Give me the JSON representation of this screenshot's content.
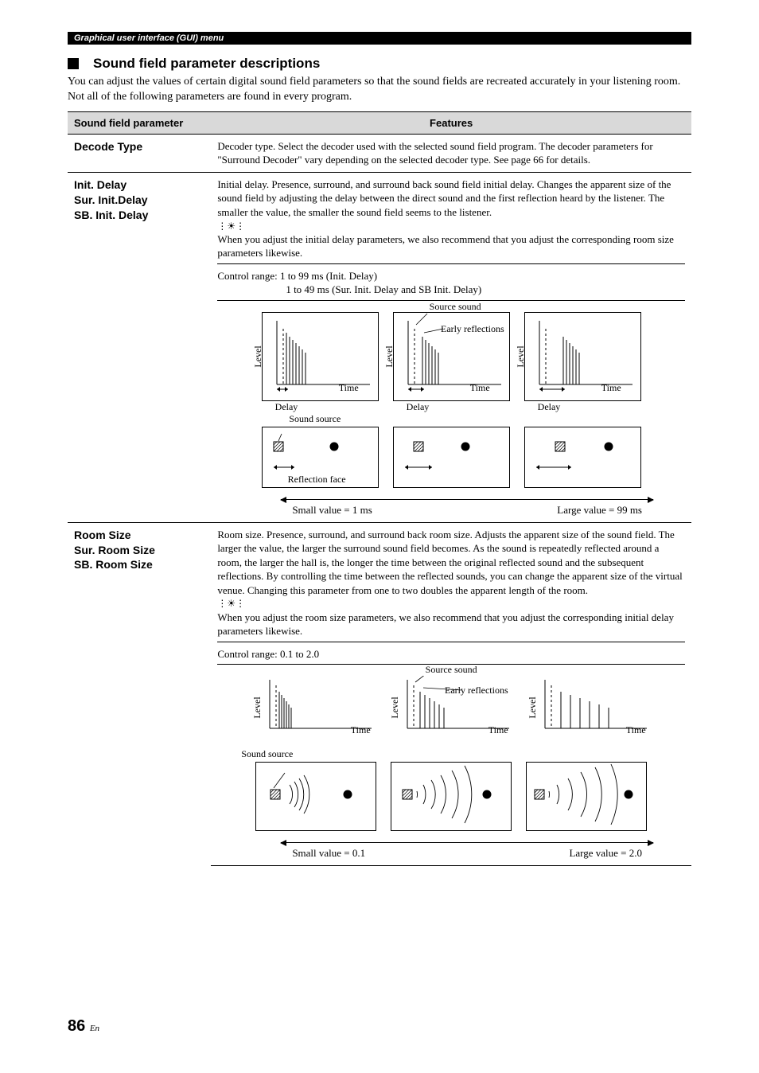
{
  "header_bar": "Graphical user interface (GUI) menu",
  "section_title": "Sound field parameter descriptions",
  "intro": "You can adjust the values of certain digital sound field parameters so that the sound fields are recreated accurately in your listening room. Not all of the following parameters are found in every program.",
  "table": {
    "col1": "Sound field parameter",
    "col2": "Features"
  },
  "rows": {
    "decode": {
      "name": "Decode Type",
      "feat": "Decoder type. Select the decoder used with the selected sound field program. The decoder parameters for \"Surround Decoder\" vary depending on the selected decoder type. See page 66 for details."
    },
    "init_delay": {
      "name1": "Init. Delay",
      "name2": "Sur. Init.Delay",
      "name3": "SB. Init. Delay",
      "feat_p1": "Initial delay. Presence, surround, and surround back sound field initial delay. Changes the apparent size of the sound field by adjusting the delay between the direct sound and the first reflection heard by the listener. The smaller the value, the smaller the sound field seems to the listener.",
      "feat_p2": "When you adjust the initial delay parameters, we also recommend that you adjust the corresponding room size parameters likewise.",
      "range1": "Control range: 1 to 99 ms (Init. Delay)",
      "range2": "1 to 49 ms (Sur. Init. Delay and SB Init. Delay)",
      "label_level": "Level",
      "label_time": "Time",
      "label_delay": "Delay",
      "label_source_sound": "Source sound",
      "label_early": "Early reflections",
      "label_sound_source": "Sound source",
      "label_reflection_face": "Reflection face",
      "small_v": "Small value = 1 ms",
      "large_v": "Large value = 99 ms"
    },
    "room_size": {
      "name1": "Room Size",
      "name2": "Sur. Room Size",
      "name3": "SB. Room Size",
      "feat_p1": "Room size. Presence, surround, and surround back room size. Adjusts the apparent size of the sound field. The larger the value, the larger the surround sound field becomes. As the sound is repeatedly reflected around a room, the larger the hall is, the longer the time between the original reflected sound and the subsequent reflections. By controlling the time between the reflected sounds, you can change the apparent size of the virtual venue. Changing this parameter from one to two doubles the apparent length of the room.",
      "feat_p2": "When you adjust the room size parameters, we also recommend that you adjust the corresponding initial delay parameters likewise.",
      "range": "Control range: 0.1 to 2.0",
      "label_level": "Level",
      "label_time": "Time",
      "label_source_sound": "Source sound",
      "label_early": "Early reflections",
      "label_sound_source": "Sound source",
      "small_v": "Small value = 0.1",
      "large_v": "Large value = 2.0"
    }
  },
  "page_number": "86",
  "page_lang": "En"
}
